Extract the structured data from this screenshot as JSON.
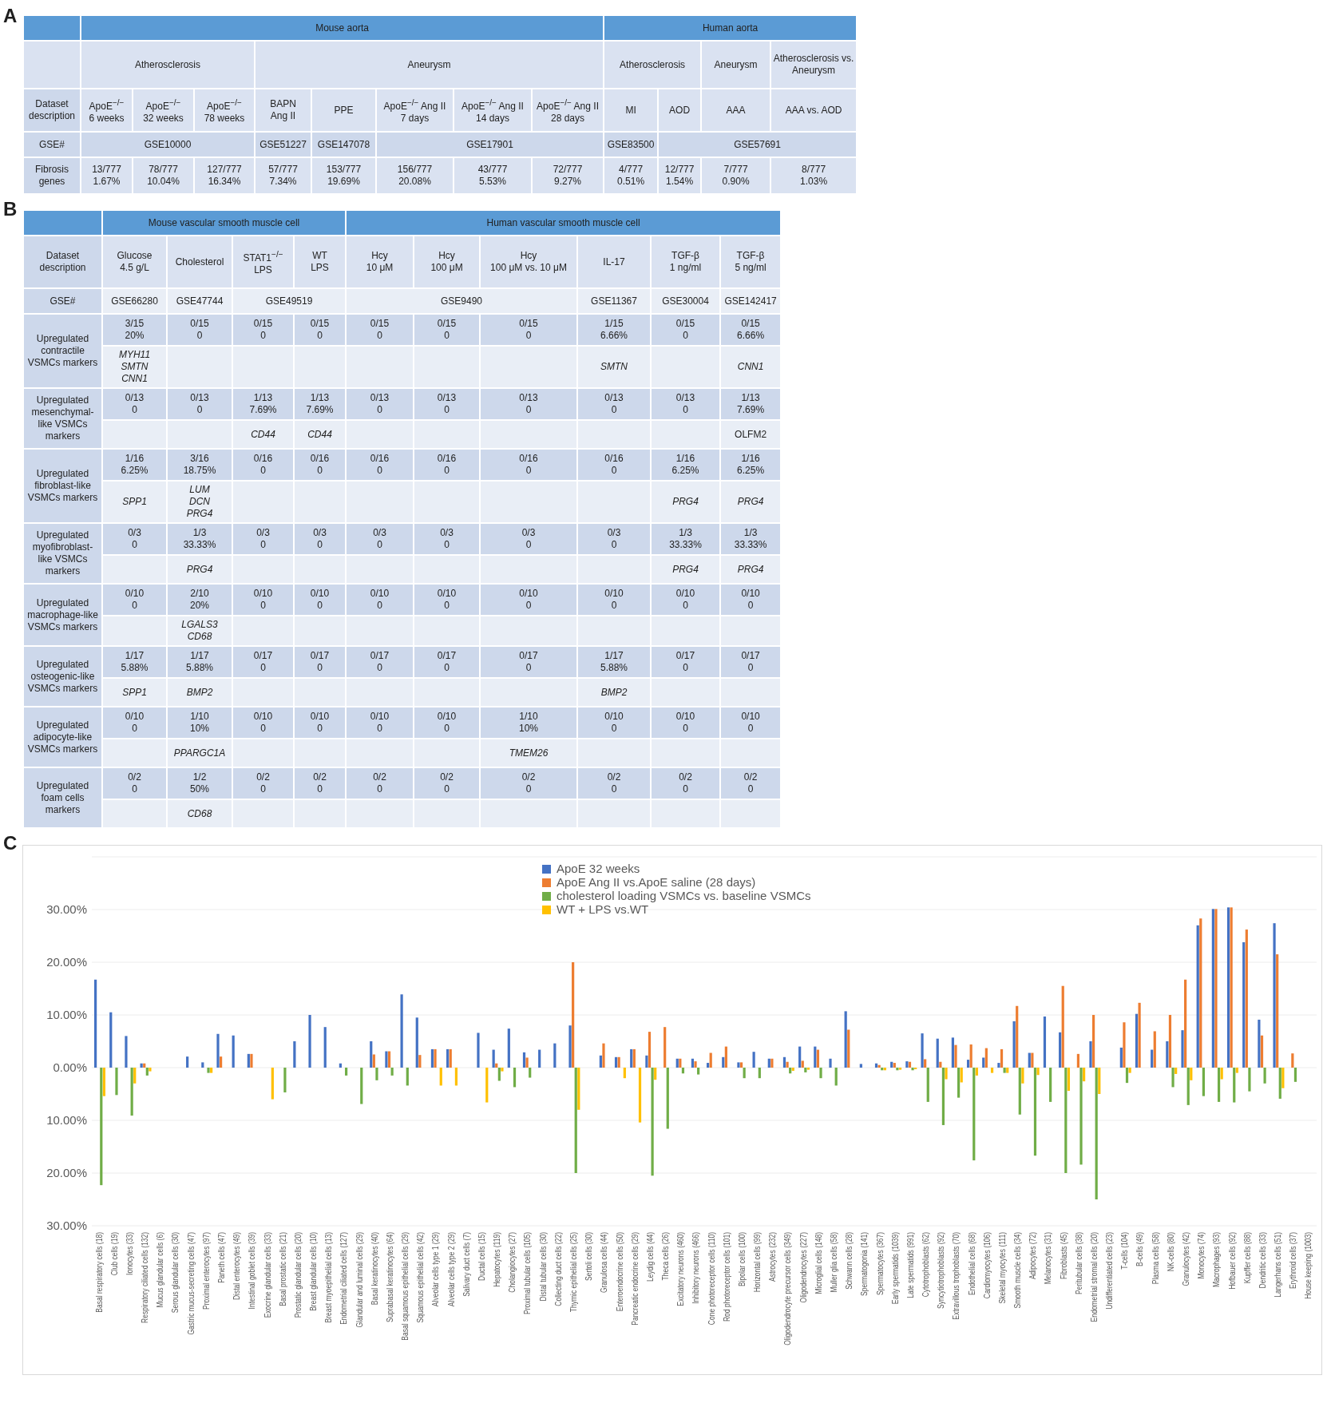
{
  "panel_a": {
    "label": "A",
    "species": [
      {
        "text": "Mouse aorta",
        "colspan": 8
      },
      {
        "text": "Human aorta",
        "colspan": 4
      }
    ],
    "diseases": [
      {
        "text": "Atherosclerosis",
        "colspan": 3
      },
      {
        "text": "Aneurysm",
        "colspan": 5
      },
      {
        "text": "Atherosclerosis",
        "colspan": 2
      },
      {
        "text": "Aneurysm"
      },
      {
        "text": "Atherosclerosis vs. Aneurysm"
      }
    ],
    "rows": [
      {
        "header": "Dataset description",
        "cells": [
          {
            "lines": [
              "ApoE$^{−/−}$",
              "6 weeks"
            ]
          },
          {
            "lines": [
              "ApoE$^{−/−}$",
              "32 weeks"
            ]
          },
          {
            "lines": [
              "ApoE$^{−/−}$",
              "78 weeks"
            ]
          },
          {
            "lines": [
              "BAPN",
              "Ang II"
            ]
          },
          {
            "lines": [
              "PPE"
            ]
          },
          {
            "lines": [
              "ApoE$^{−/−}$ Ang II",
              "7 days"
            ]
          },
          {
            "lines": [
              "ApoE$^{−/−}$ Ang II",
              "14 days"
            ]
          },
          {
            "lines": [
              "ApoE$^{−/−}$ Ang II",
              "28 days"
            ]
          },
          {
            "lines": [
              "MI"
            ]
          },
          {
            "lines": [
              "AOD"
            ]
          },
          {
            "lines": [
              "AAA"
            ]
          },
          {
            "lines": [
              "AAA vs. AOD"
            ]
          }
        ]
      },
      {
        "header": "GSE#",
        "cells": [
          {
            "lines": [
              "GSE10000"
            ],
            "colspan": 3
          },
          {
            "lines": [
              "GSE51227"
            ]
          },
          {
            "lines": [
              "GSE147078"
            ]
          },
          {
            "lines": [
              "GSE17901"
            ],
            "colspan": 3
          },
          {
            "lines": [
              "GSE83500"
            ]
          },
          {
            "lines": [
              "GSE57691"
            ],
            "colspan": 3
          }
        ]
      },
      {
        "header": "Fibrosis genes",
        "cells": [
          {
            "lines": [
              "13/777",
              "1.67%"
            ]
          },
          {
            "lines": [
              "78/777",
              "10.04%"
            ]
          },
          {
            "lines": [
              "127/777",
              "16.34%"
            ]
          },
          {
            "lines": [
              "57/777",
              "7.34%"
            ]
          },
          {
            "lines": [
              "153/777",
              "19.69%"
            ]
          },
          {
            "lines": [
              "156/777",
              "20.08%"
            ]
          },
          {
            "lines": [
              "43/777",
              "5.53%"
            ]
          },
          {
            "lines": [
              "72/777",
              "9.27%"
            ]
          },
          {
            "lines": [
              "4/777",
              "0.51%"
            ]
          },
          {
            "lines": [
              "12/777",
              "1.54%"
            ]
          },
          {
            "lines": [
              "7/777",
              "0.90%"
            ]
          },
          {
            "lines": [
              "8/777",
              "1.03%"
            ]
          }
        ]
      }
    ]
  },
  "panel_b": {
    "label": "B",
    "species": [
      {
        "text": "Mouse vascular smooth muscle cell",
        "colspan": 4
      },
      {
        "text": "Human vascular smooth muscle cell",
        "colspan": 6
      }
    ],
    "rows": [
      {
        "header": "Dataset description",
        "cells": [
          {
            "lines": [
              "Glucose",
              "4.5 g/L"
            ]
          },
          {
            "lines": [
              "Cholesterol"
            ]
          },
          {
            "lines": [
              "STAT1$^{−/−}$",
              "LPS"
            ]
          },
          {
            "lines": [
              "WT",
              "LPS"
            ]
          },
          {
            "lines": [
              "Hcy",
              "10 μM"
            ]
          },
          {
            "lines": [
              "Hcy",
              "100 μM"
            ]
          },
          {
            "lines": [
              "Hcy",
              "100 μM vs. 10 μM"
            ]
          },
          {
            "lines": [
              "IL-17"
            ]
          },
          {
            "lines": [
              "TGF-β",
              "1 ng/ml"
            ]
          },
          {
            "lines": [
              "TGF-β",
              "5 ng/ml"
            ]
          }
        ]
      },
      {
        "header": "GSE#",
        "cells": [
          {
            "lines": [
              "GSE66280"
            ]
          },
          {
            "lines": [
              "GSE47744"
            ]
          },
          {
            "lines": [
              "GSE49519"
            ],
            "colspan": 2
          },
          {
            "lines": [
              "GSE9490"
            ],
            "colspan": 3
          },
          {
            "lines": [
              "GSE11367"
            ]
          },
          {
            "lines": [
              "GSE30004"
            ]
          },
          {
            "lines": [
              "GSE142417"
            ]
          }
        ]
      }
    ],
    "marker_groups": [
      {
        "label": "Upregulated contractile VSMCs markers",
        "cells": [
          {
            "count": "3/15",
            "percent": "20%",
            "genes": [
              "MYH11",
              "SMTN",
              "CNN1"
            ],
            "italic": true
          },
          {
            "count": "0/15",
            "percent": "0"
          },
          {
            "count": "0/15",
            "percent": "0"
          },
          {
            "count": "0/15",
            "percent": "0"
          },
          {
            "count": "0/15",
            "percent": "0"
          },
          {
            "count": "0/15",
            "percent": "0"
          },
          {
            "count": "0/15",
            "percent": "0"
          },
          {
            "count": "1/15",
            "percent": "6.66%",
            "genes": [
              "SMTN"
            ],
            "italic": true
          },
          {
            "count": "0/15",
            "percent": "0"
          },
          {
            "count": "0/15",
            "percent": "6.66%",
            "genes": [
              "CNN1"
            ],
            "italic": true
          }
        ]
      },
      {
        "label": "Upregulated mesenchymal-like VSMCs markers",
        "cells": [
          {
            "count": "0/13",
            "percent": "0"
          },
          {
            "count": "0/13",
            "percent": "0"
          },
          {
            "count": "1/13",
            "percent": "7.69%",
            "genes": [
              "CD44"
            ],
            "italic": true
          },
          {
            "count": "1/13",
            "percent": "7.69%",
            "genes": [
              "CD44"
            ],
            "italic": true
          },
          {
            "count": "0/13",
            "percent": "0"
          },
          {
            "count": "0/13",
            "percent": "0"
          },
          {
            "count": "0/13",
            "percent": "0"
          },
          {
            "count": "0/13",
            "percent": "0"
          },
          {
            "count": "0/13",
            "percent": "0"
          },
          {
            "count": "1/13",
            "percent": "7.69%",
            "genes": [
              "OLFM2"
            ],
            "italic": false
          }
        ]
      },
      {
        "label": "Upregulated fibroblast-like VSMCs markers",
        "cells": [
          {
            "count": "1/16",
            "percent": "6.25%",
            "genes": [
              "SPP1"
            ],
            "italic": true
          },
          {
            "count": "3/16",
            "percent": "18.75%",
            "genes": [
              "LUM",
              "DCN",
              "PRG4"
            ],
            "italic": true
          },
          {
            "count": "0/16",
            "percent": "0"
          },
          {
            "count": "0/16",
            "percent": "0"
          },
          {
            "count": "0/16",
            "percent": "0"
          },
          {
            "count": "0/16",
            "percent": "0"
          },
          {
            "count": "0/16",
            "percent": "0"
          },
          {
            "count": "0/16",
            "percent": "0"
          },
          {
            "count": "1/16",
            "percent": "6.25%",
            "genes": [
              "PRG4"
            ],
            "italic": true
          },
          {
            "count": "1/16",
            "percent": "6.25%",
            "genes": [
              "PRG4"
            ],
            "italic": true
          }
        ]
      },
      {
        "label": "Upregulated myofibroblast-like VSMCs markers",
        "cells": [
          {
            "count": "0/3",
            "percent": "0"
          },
          {
            "count": "1/3",
            "percent": "33.33%",
            "genes": [
              "PRG4"
            ],
            "italic": true
          },
          {
            "count": "0/3",
            "percent": "0"
          },
          {
            "count": "0/3",
            "percent": "0"
          },
          {
            "count": "0/3",
            "percent": "0"
          },
          {
            "count": "0/3",
            "percent": "0"
          },
          {
            "count": "0/3",
            "percent": "0"
          },
          {
            "count": "0/3",
            "percent": "0"
          },
          {
            "count": "1/3",
            "percent": "33.33%",
            "genes": [
              "PRG4"
            ],
            "italic": true
          },
          {
            "count": "1/3",
            "percent": "33.33%",
            "genes": [
              "PRG4"
            ],
            "italic": true
          }
        ]
      },
      {
        "label": "Upregulated macrophage-like VSMCs markers",
        "cells": [
          {
            "count": "0/10",
            "percent": "0"
          },
          {
            "count": "2/10",
            "percent": "20%",
            "genes": [
              "LGALS3",
              "CD68"
            ],
            "italic": true
          },
          {
            "count": "0/10",
            "percent": "0"
          },
          {
            "count": "0/10",
            "percent": "0"
          },
          {
            "count": "0/10",
            "percent": "0"
          },
          {
            "count": "0/10",
            "percent": "0"
          },
          {
            "count": "0/10",
            "percent": "0"
          },
          {
            "count": "0/10",
            "percent": "0"
          },
          {
            "count": "0/10",
            "percent": "0"
          },
          {
            "count": "0/10",
            "percent": "0"
          }
        ]
      },
      {
        "label": "Upregulated osteogenic-like VSMCs markers",
        "cells": [
          {
            "count": "1/17",
            "percent": "5.88%",
            "genes": [
              "SPP1"
            ],
            "italic": true
          },
          {
            "count": "1/17",
            "percent": "5.88%",
            "genes": [
              "BMP2"
            ],
            "italic": true
          },
          {
            "count": "0/17",
            "percent": "0"
          },
          {
            "count": "0/17",
            "percent": "0"
          },
          {
            "count": "0/17",
            "percent": "0"
          },
          {
            "count": "0/17",
            "percent": "0"
          },
          {
            "count": "0/17",
            "percent": "0"
          },
          {
            "count": "1/17",
            "percent": "5.88%",
            "genes": [
              "BMP2"
            ],
            "italic": true
          },
          {
            "count": "0/17",
            "percent": "0"
          },
          {
            "count": "0/17",
            "percent": "0"
          }
        ]
      },
      {
        "label": "Upregulated adipocyte-like VSMCs markers",
        "cells": [
          {
            "count": "0/10",
            "percent": "0"
          },
          {
            "count": "1/10",
            "percent": "10%",
            "genes": [
              "PPARGC1A"
            ],
            "italic": true
          },
          {
            "count": "0/10",
            "percent": "0"
          },
          {
            "count": "0/10",
            "percent": "0"
          },
          {
            "count": "0/10",
            "percent": "0"
          },
          {
            "count": "0/10",
            "percent": "0"
          },
          {
            "count": "1/10",
            "percent": "10%",
            "genes": [
              "TMEM26"
            ],
            "italic": true
          },
          {
            "count": "0/10",
            "percent": "0"
          },
          {
            "count": "0/10",
            "percent": "0"
          },
          {
            "count": "0/10",
            "percent": "0"
          }
        ]
      },
      {
        "label": "Upregulated foam cells markers",
        "cells": [
          {
            "count": "0/2",
            "percent": "0"
          },
          {
            "count": "1/2",
            "percent": "50%",
            "genes": [
              "CD68"
            ],
            "italic": true
          },
          {
            "count": "0/2",
            "percent": "0"
          },
          {
            "count": "0/2",
            "percent": "0"
          },
          {
            "count": "0/2",
            "percent": "0"
          },
          {
            "count": "0/2",
            "percent": "0"
          },
          {
            "count": "0/2",
            "percent": "0"
          },
          {
            "count": "0/2",
            "percent": "0"
          },
          {
            "count": "0/2",
            "percent": "0"
          },
          {
            "count": "0/2",
            "percent": "0"
          }
        ]
      }
    ]
  },
  "panel_c": {
    "label": "C",
    "chart_data": {
      "type": "bar",
      "categories": [
        "Basal respiratory cells (18)",
        "Club cells (19)",
        "Ionocytes (33)",
        "Respiratory ciliated cells (132)",
        "Mucus glandular cells (6)",
        "Serous glandular cells (30)",
        "Gastric mucus-secreting cells (47)",
        "Proximal enterocytes (97)",
        "Paneth cells (47)",
        "Distal enterocytes (49)",
        "Intestinal goblet cells (39)",
        "Exocrine glandular cells (33)",
        "Basal prostatic cells (21)",
        "Prostatic glandular cells (20)",
        "Breast glandular cells (10)",
        "Breast myoepithelial cells (13)",
        "Endometrial ciliated cells (127)",
        "Glandular and luminal cells (29)",
        "Basal keratinocytes (40)",
        "Suprabasal keratinocytes (64)",
        "Basal squamous epithelial cells (29)",
        "Squamous epithelial cells (42)",
        "Alveolar cells type 1 (29)",
        "Alveolar cells type 2 (29)",
        "Salivary duct cells (7)",
        "Ductal cells (15)",
        "Hepatocytes (119)",
        "Cholangiocytes (27)",
        "Proximal tubular cells (105)",
        "Distal tubular cells (30)",
        "Collecting duct cells (22)",
        "Thymic epithelial cells (25)",
        "Sertoli cells (30)",
        "Granulosa cells (44)",
        "Enteroendocrine cells (50)",
        "Pancreatic endocrine cells (29)",
        "Leydig cells (44)",
        "Theca cells (26)",
        "Excitatory neurons (460)",
        "Inhibitory neurons (466)",
        "Cone photoreceptor cells (110)",
        "Rod photoreceptor cells (101)",
        "Bipolar cells (100)",
        "Horizontal cells (99)",
        "Astrocytes (232)",
        "Oligodendrocyte precursor cells (349)",
        "Oligodendrocytes (227)",
        "Microglial cells (148)",
        "Muller glia cells (58)",
        "Schwann cells (28)",
        "Spermatogonia (141)",
        "Spermatocytes (367)",
        "Early spermatids (1039)",
        "Late spermatids (991)",
        "Cytotrophoblasts (62)",
        "Syncytiotrophoblasts (92)",
        "Extravillous trophoblasts (70)",
        "Endothelial cells (68)",
        "Cardiomyocytes (106)",
        "Skeletal myocytes (111)",
        "Smooth muscle cells (34)",
        "Adipocytes (72)",
        "Melanocytes (31)",
        "Fibroblasts (45)",
        "Peritubular cells (38)",
        "Endometrial stromal cells (20)",
        "Undifferentiated cells (23)",
        "T-cells (104)",
        "B-cells (49)",
        "Plasma cells (58)",
        "NK-cells (80)",
        "Granulocytes (42)",
        "Monocytes (74)",
        "Macrophages (93)",
        "Hofbauer cells (92)",
        "Kupffer cells (88)",
        "Dendritic cells (33)",
        "Langerhans cells (51)",
        "Erythroid cells (37)",
        "House keeping (1003)"
      ],
      "series": [
        {
          "name": "ApoE 32 weeks",
          "color": "#4472c4",
          "values": [
            16.7,
            10.5,
            6.0,
            0.8,
            0,
            0,
            2.1,
            1.0,
            6.4,
            6.1,
            2.6,
            0,
            0,
            5.0,
            10.0,
            7.7,
            0.8,
            0,
            5.0,
            3.1,
            13.9,
            9.5,
            3.5,
            3.5,
            0,
            6.6,
            3.4,
            7.4,
            2.9,
            3.4,
            4.6,
            8.0,
            0,
            2.3,
            2.0,
            3.5,
            2.3,
            0,
            1.7,
            1.7,
            0.9,
            2.0,
            1.0,
            3.0,
            1.7,
            2.0,
            4.0,
            4.0,
            1.7,
            10.7,
            0.7,
            0.8,
            1.1,
            1.2,
            6.5,
            5.5,
            5.7,
            1.5,
            1.9,
            0.9,
            8.8,
            2.8,
            9.7,
            6.7,
            0,
            5.0,
            0,
            3.8,
            10.2,
            3.4,
            5.0,
            7.1,
            27.0,
            30.1,
            30.4,
            23.8,
            9.1,
            27.4,
            0,
            0
          ]
        },
        {
          "name": "ApoE Ang II vs.ApoE saline (28 days)",
          "color": "#ed7d31",
          "values": [
            0,
            0,
            0,
            0.8,
            0,
            0,
            0,
            0,
            2.1,
            0,
            2.6,
            0,
            0,
            0,
            0,
            0,
            0,
            0,
            2.5,
            3.1,
            0,
            2.4,
            3.5,
            3.5,
            0,
            0,
            0.8,
            0,
            1.9,
            0,
            0,
            20.0,
            0,
            4.6,
            2.0,
            3.5,
            6.8,
            7.7,
            1.7,
            1.2,
            2.8,
            4.0,
            1.0,
            0,
            1.7,
            1.1,
            1.3,
            3.4,
            0,
            7.2,
            0,
            0.5,
            0.9,
            1.1,
            1.6,
            1.1,
            4.3,
            4.4,
            3.7,
            3.5,
            11.7,
            2.8,
            0,
            15.5,
            2.6,
            10.0,
            0,
            8.6,
            12.3,
            6.9,
            10.0,
            16.7,
            28.3,
            30.1,
            30.4,
            26.2,
            6.1,
            21.5,
            2.7,
            0
          ]
        },
        {
          "name": "cholesterol loading VSMCs vs. baseline VSMCs",
          "color": "#70ad47",
          "values": [
            -22.3,
            -5.2,
            -9.1,
            -1.5,
            0,
            0,
            0,
            -1.0,
            0,
            0,
            0,
            0,
            -4.7,
            0,
            0,
            0,
            -1.5,
            -6.9,
            -2.4,
            -1.5,
            -3.4,
            0,
            0,
            0,
            0,
            0,
            -2.5,
            -3.7,
            -1.9,
            0,
            0,
            -20.0,
            0,
            0,
            0,
            0,
            -20.5,
            -11.6,
            -1.1,
            -1.3,
            0,
            0,
            -2.0,
            -2.0,
            0,
            -1.1,
            -0.9,
            -2.0,
            -3.4,
            0,
            0,
            -0.5,
            -0.5,
            -0.5,
            -6.5,
            -10.9,
            -5.7,
            -17.6,
            0,
            -1.0,
            -8.9,
            -16.7,
            -6.5,
            -20.0,
            -18.4,
            -25.0,
            0,
            -2.9,
            0,
            0,
            -3.7,
            -7.1,
            -5.4,
            -6.5,
            -6.6,
            -4.5,
            -3.0,
            -5.9,
            -2.7,
            0
          ]
        },
        {
          "name": "WT + LPS vs.WT",
          "color": "#ffc000",
          "values": [
            -5.4,
            0,
            -3.0,
            -0.7,
            0,
            0,
            0,
            -1.0,
            0,
            0,
            0,
            -6.0,
            0,
            0,
            0,
            0,
            0,
            0,
            0,
            0,
            0,
            0,
            -3.4,
            -3.4,
            0,
            -6.6,
            -0.7,
            0,
            0,
            0,
            0,
            -8.0,
            0,
            0,
            -2.0,
            -10.4,
            -2.3,
            0,
            0,
            0,
            0,
            0,
            0,
            0,
            0,
            -0.6,
            -0.4,
            0,
            0,
            0,
            0,
            -0.5,
            -0.4,
            -0.3,
            0,
            -2.2,
            -2.8,
            -1.5,
            -1.0,
            -1.0,
            -3.0,
            -1.4,
            0,
            -4.4,
            -2.6,
            -5.0,
            0,
            -1.0,
            0,
            0,
            -1.2,
            -2.4,
            0,
            -2.2,
            -1.0,
            0,
            0,
            -3.9,
            0,
            0
          ]
        }
      ],
      "ylim": [
        -30,
        40
      ],
      "yticks": [
        {
          "value": 30,
          "label": "30.00%"
        },
        {
          "value": 20,
          "label": "20.00%"
        },
        {
          "value": 10,
          "label": "10.00%"
        },
        {
          "value": 0,
          "label": "0.00%"
        },
        {
          "value": -10,
          "label": "10.00%"
        },
        {
          "value": -20,
          "label": "20.00%"
        },
        {
          "value": -30,
          "label": "30.00%"
        }
      ],
      "grid": true,
      "legend": true
    }
  }
}
